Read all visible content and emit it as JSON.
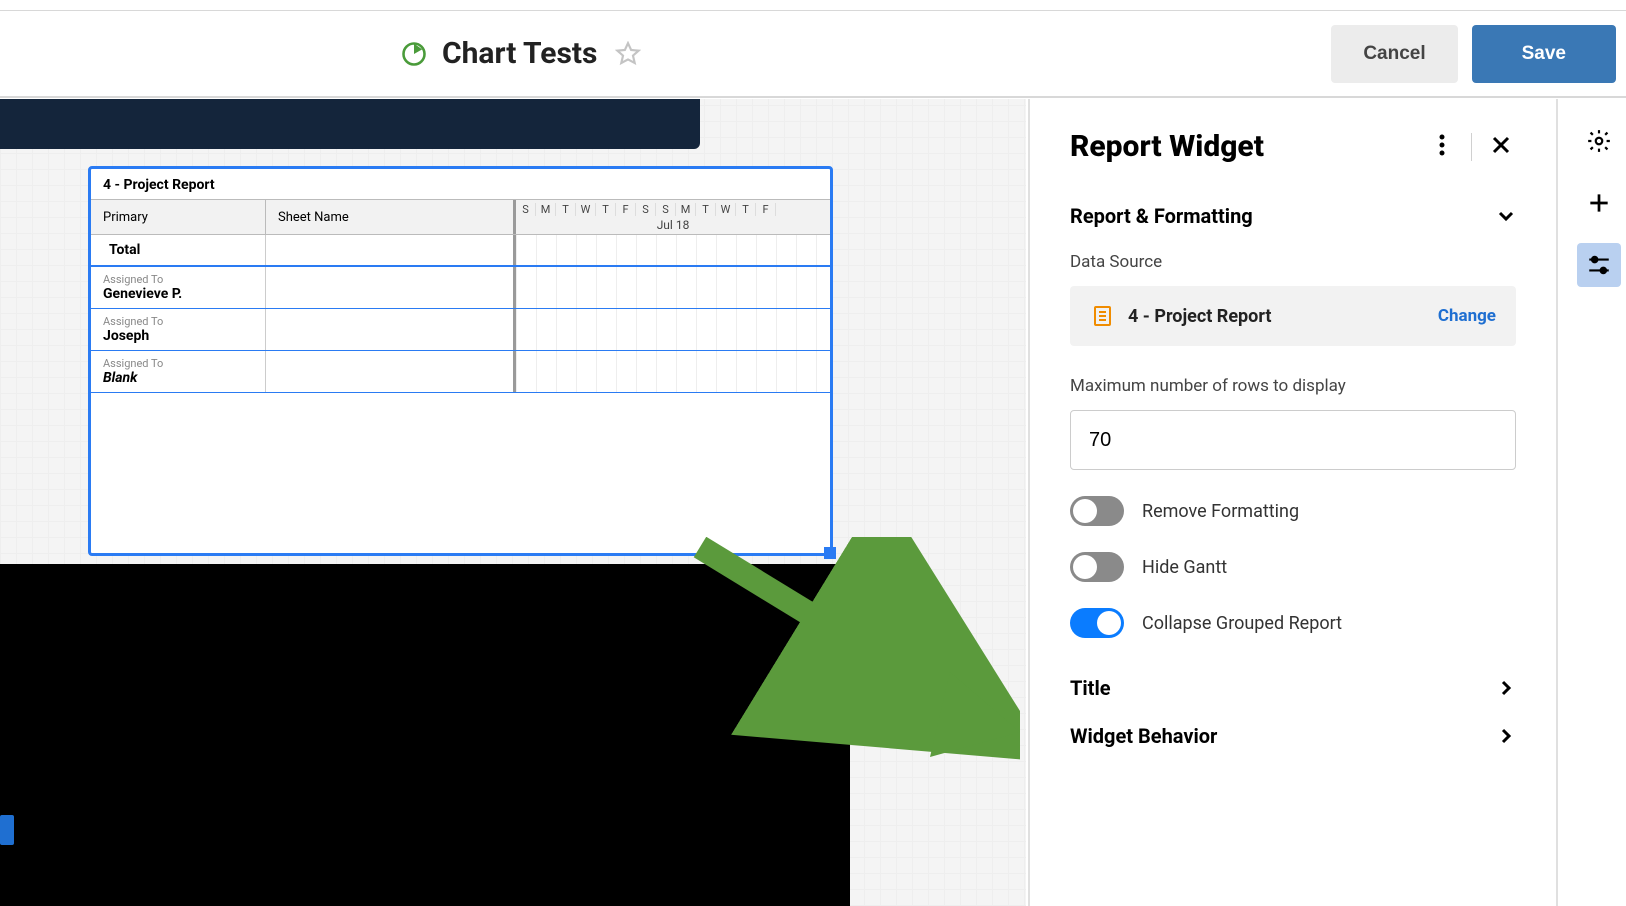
{
  "header": {
    "title": "Chart Tests",
    "cancel": "Cancel",
    "save": "Save"
  },
  "widget": {
    "title": "4 - Project Report",
    "columns": {
      "primary": "Primary",
      "sheet": "Sheet Name"
    },
    "gantt": {
      "month": "Jul 18",
      "days": [
        "S",
        "M",
        "T",
        "W",
        "T",
        "F",
        "S",
        "S",
        "M",
        "T",
        "W",
        "T",
        "F"
      ]
    },
    "rows": {
      "total": "Total",
      "assigned_label": "Assigned To",
      "r1": "Genevieve P.",
      "r2": "Joseph",
      "r3": "Blank"
    }
  },
  "panel": {
    "title": "Report Widget",
    "section_reporting": "Report & Formatting",
    "data_source_label": "Data Source",
    "data_source_name": "4 - Project Report",
    "change": "Change",
    "max_rows_label": "Maximum number of rows to display",
    "max_rows_value": "70",
    "toggle_remove": "Remove Formatting",
    "toggle_hide": "Hide Gantt",
    "toggle_collapse": "Collapse Grouped Report",
    "section_title": "Title",
    "section_behavior": "Widget Behavior"
  }
}
